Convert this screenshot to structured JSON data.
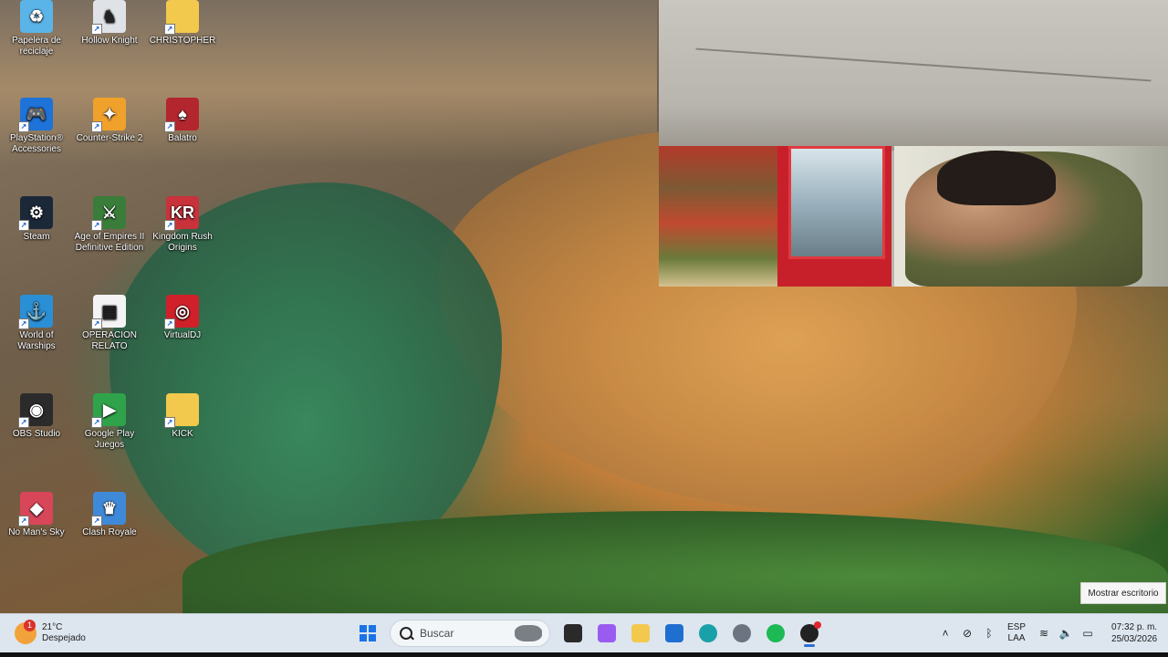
{
  "desktop": {
    "icons": [
      {
        "label": "Papelera de reciclaje",
        "icon": "recycle-bin-icon",
        "color": "#5ab4e8",
        "glyph": "♻"
      },
      {
        "label": "Hollow Knight",
        "icon": "hollow-knight-icon",
        "color": "#dfe3e8",
        "glyph": "♞"
      },
      {
        "label": "CHRISTOPHER",
        "icon": "folder-icon",
        "color": "#f2c94c",
        "glyph": ""
      },
      {
        "label": "PlayStation® Accessories",
        "icon": "playstation-accessories-icon",
        "color": "#1e73d8",
        "glyph": "🎮"
      },
      {
        "label": "Counter-Strike 2",
        "icon": "counter-strike-icon",
        "color": "#f0a12b",
        "glyph": "✦"
      },
      {
        "label": "Balatro",
        "icon": "balatro-icon",
        "color": "#b3262e",
        "glyph": "♠"
      },
      {
        "label": "Steam",
        "icon": "steam-icon",
        "color": "#1b2838",
        "glyph": "⚙"
      },
      {
        "label": "Age of Empires II Definitive Edition",
        "icon": "age-of-empires-icon",
        "color": "#3a7d3a",
        "glyph": "⚔"
      },
      {
        "label": "Kingdom Rush Origins",
        "icon": "kingdom-rush-icon",
        "color": "#c8323a",
        "glyph": "KR"
      },
      {
        "label": "World of Warships",
        "icon": "world-of-warships-icon",
        "color": "#2b8fd6",
        "glyph": "⚓"
      },
      {
        "label": "OPERACION RELATO",
        "icon": "video-file-icon",
        "color": "#f4f4f4",
        "glyph": "▤"
      },
      {
        "label": "VirtualDJ",
        "icon": "virtualdj-icon",
        "color": "#d0202a",
        "glyph": "◎"
      },
      {
        "label": "OBS Studio",
        "icon": "obs-studio-icon",
        "color": "#2b2b2b",
        "glyph": "◉"
      },
      {
        "label": "Google Play Juegos",
        "icon": "google-play-games-icon",
        "color": "#2fa34a",
        "glyph": "▶"
      },
      {
        "label": "KICK",
        "icon": "folder-icon",
        "color": "#f2c94c",
        "glyph": ""
      },
      {
        "label": "No Man's Sky",
        "icon": "no-mans-sky-icon",
        "color": "#d8465a",
        "glyph": "◆"
      },
      {
        "label": "Clash Royale",
        "icon": "clash-royale-icon",
        "color": "#3f8ad8",
        "glyph": "♛"
      }
    ]
  },
  "webcam": {
    "description": "live webcam overlay"
  },
  "tooltip": {
    "text": "Mostrar escritorio"
  },
  "taskbar": {
    "weather": {
      "temp": "21°C",
      "condition": "Despejado",
      "badge": "1"
    },
    "search": {
      "placeholder": "Buscar"
    },
    "apps": [
      {
        "name": "task-view",
        "color": "#2a2a2a"
      },
      {
        "name": "copilot",
        "color": "#9a5cf0"
      },
      {
        "name": "file-explorer",
        "color": "#f2c94c"
      },
      {
        "name": "microsoft-store",
        "color": "#1f6fd1"
      },
      {
        "name": "edge",
        "color": "#1aa0a8"
      },
      {
        "name": "settings",
        "color": "#6b7480"
      },
      {
        "name": "spotify",
        "color": "#1db954"
      },
      {
        "name": "obs",
        "color": "#222222"
      }
    ],
    "tray": {
      "lang": "ESP",
      "layout": "LAA",
      "time": "07:32 p. m.",
      "date": "25/03/2026"
    }
  }
}
